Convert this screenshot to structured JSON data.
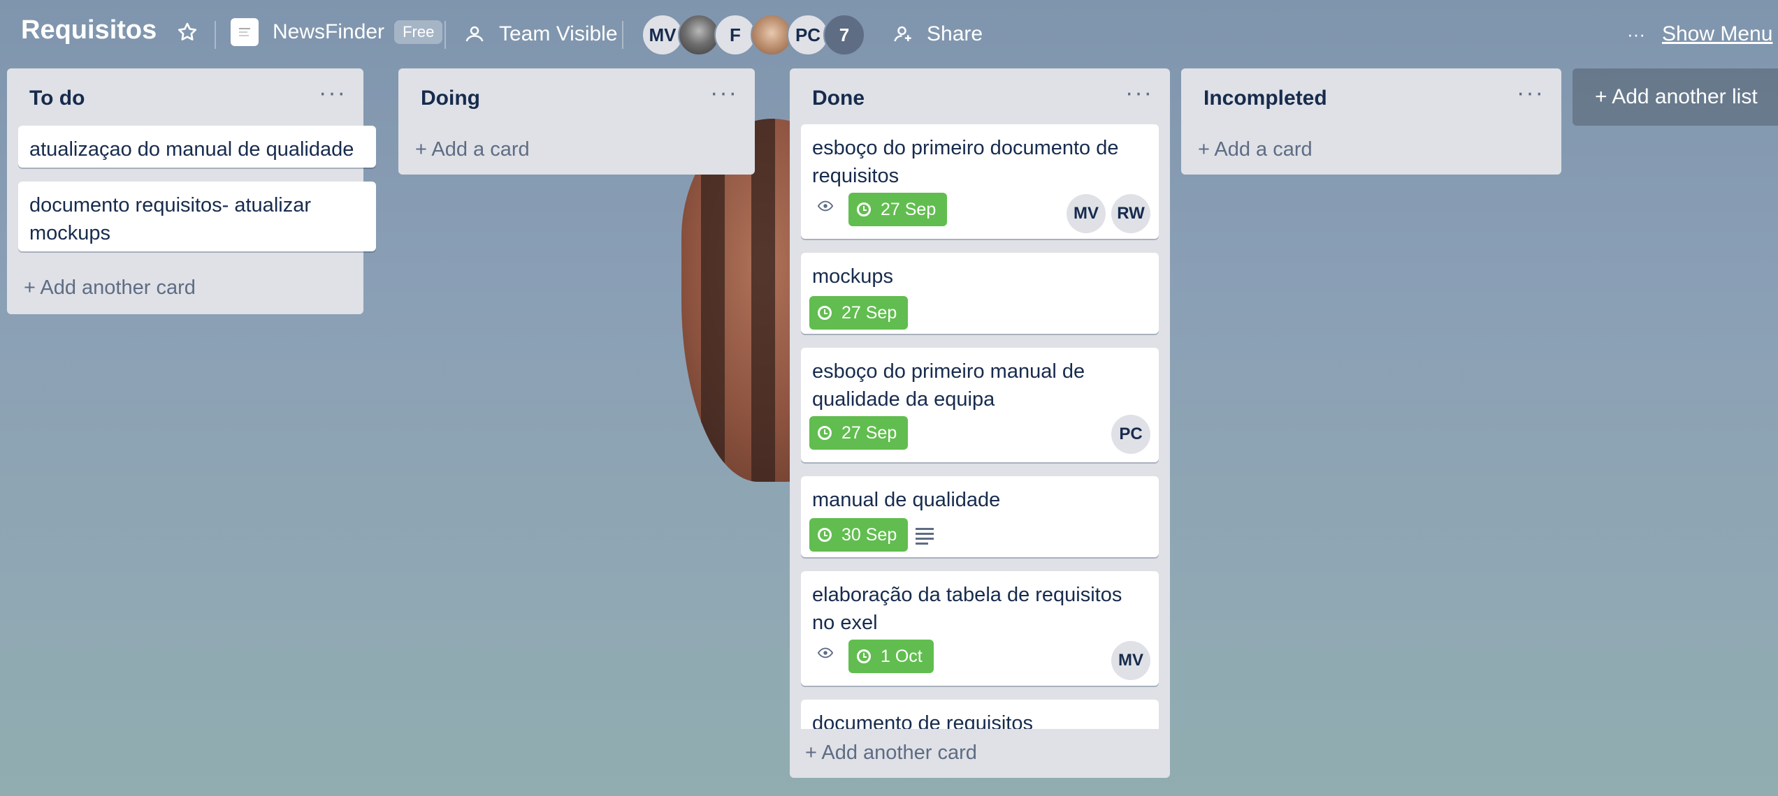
{
  "header": {
    "board_title": "Requisitos",
    "star_icon": "star-icon",
    "workspace_name": "NewsFinder",
    "workspace_badge": "Free",
    "visibility_label": "Team Visible",
    "members": [
      "MV",
      "",
      "F",
      "",
      "PC"
    ],
    "members_more": "7",
    "share_label": "Share",
    "menu_dots": "···",
    "show_menu_label": "Show Menu"
  },
  "lists": [
    {
      "title": "To do",
      "cards": [
        {
          "text": "atualizaçao do manual de qualidade"
        },
        {
          "text": "documento requisitos- atualizar mockups"
        }
      ],
      "add_label": "+ Add another card"
    },
    {
      "title": "Doing",
      "cards": [],
      "add_label": "+ Add a card"
    },
    {
      "title": "Done",
      "cards": [
        {
          "text": "esboço do primeiro documento de requisitos",
          "due": "27 Sep",
          "watching": true,
          "members": [
            "MV",
            "RW"
          ]
        },
        {
          "text": "mockups",
          "due": "27 Sep"
        },
        {
          "text": "esboço do primeiro manual de qualidade da equipa",
          "due": "27 Sep",
          "members": [
            "PC"
          ]
        },
        {
          "text": "manual de qualidade",
          "due": "30 Sep",
          "has_description": true
        },
        {
          "text": "elaboração da tabela de requisitos no exel",
          "due": "1 Oct",
          "watching": true,
          "members": [
            "MV"
          ]
        },
        {
          "text": "documento de requisitos"
        }
      ],
      "add_label": "+ Add another card"
    },
    {
      "title": "Incompleted",
      "cards": [],
      "add_label": "+ Add a card"
    }
  ],
  "add_list_label": "+ Add another list",
  "colors": {
    "due_complete": "#61bd4f",
    "list_bg": "#dfe1e6",
    "text": "#172b4d"
  }
}
